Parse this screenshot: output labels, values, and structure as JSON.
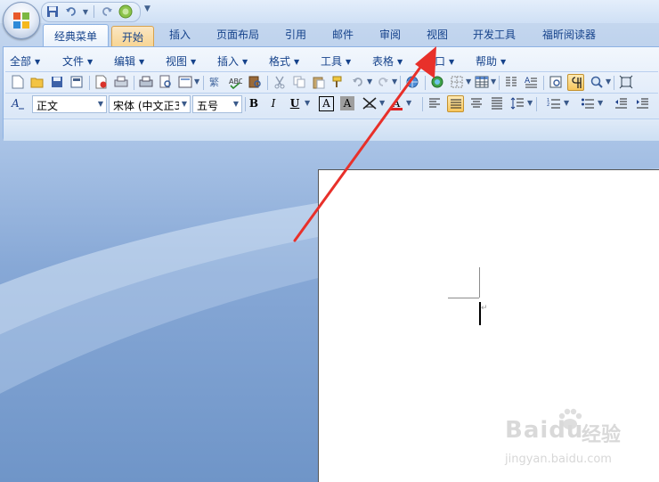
{
  "quick_access": {
    "icons": [
      "save-icon",
      "undo-icon",
      "redo-icon",
      "repeat-icon",
      "customize-quick-access-dropdown"
    ]
  },
  "tabs": [
    {
      "label": "经典菜单",
      "active": true
    },
    {
      "label": "开始",
      "active": false,
      "highlighted": true
    },
    {
      "label": "插入",
      "active": false
    },
    {
      "label": "页面布局",
      "active": false
    },
    {
      "label": "引用",
      "active": false
    },
    {
      "label": "邮件",
      "active": false
    },
    {
      "label": "审阅",
      "active": false
    },
    {
      "label": "视图",
      "active": false
    },
    {
      "label": "开发工具",
      "active": false
    },
    {
      "label": "福昕阅读器",
      "active": false
    }
  ],
  "classic_menu": [
    {
      "label": "全部"
    },
    {
      "label": "文件"
    },
    {
      "label": "编辑"
    },
    {
      "label": "视图"
    },
    {
      "label": "插入"
    },
    {
      "label": "格式"
    },
    {
      "label": "工具"
    },
    {
      "label": "表格"
    },
    {
      "label": "窗口"
    },
    {
      "label": "帮助"
    }
  ],
  "format_bar": {
    "style_value": "正文",
    "font_value": "宋体 (中文正3",
    "size_value": "五号",
    "bold_label": "B",
    "italic_label": "I",
    "underline_label": "U",
    "char_border_label": "A",
    "char_shade_label": "A",
    "font_color_label": "A"
  },
  "watermark": {
    "brand": "Baidu",
    "suffix": "经验",
    "url": "jingyan.baidu.com"
  },
  "colors": {
    "accent_tab": "#f7d38f",
    "annotation_arrow": "#e8302a",
    "selected_button": "#f7c65c"
  }
}
